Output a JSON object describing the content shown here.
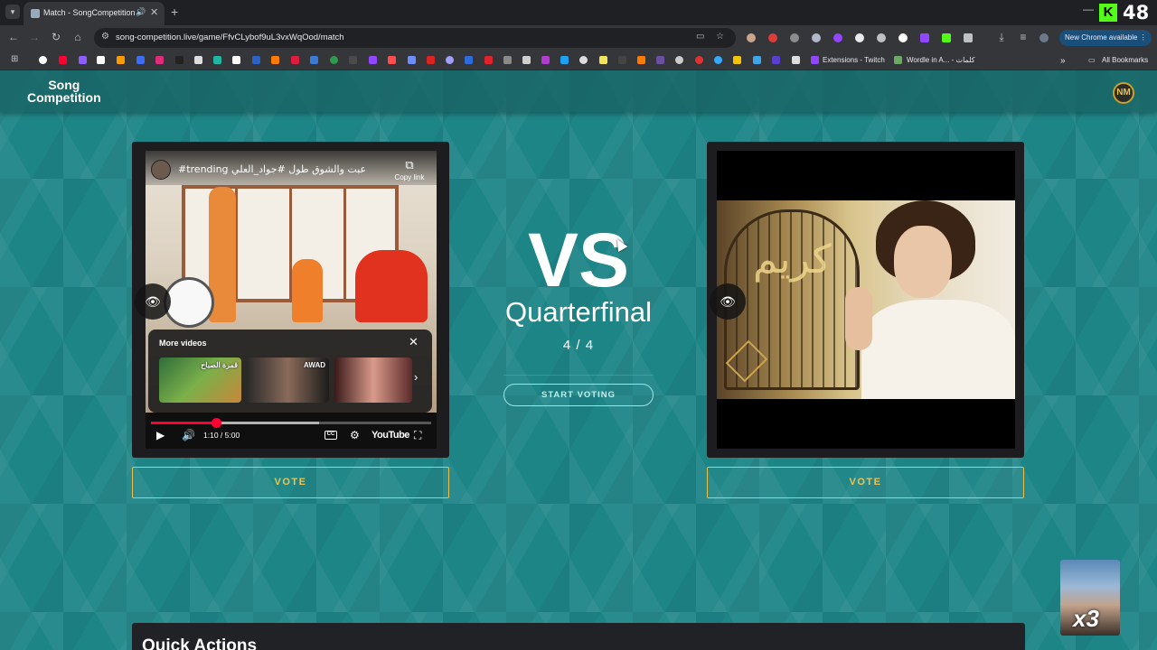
{
  "browser": {
    "tab_title": "Match - SongCompetition",
    "url": "song-competition.live/game/FfvCLybof9uL3vxWqOod/match",
    "update_button": "New Chrome available",
    "kick_count": "48",
    "bookmarks": {
      "extensions_label": "Extensions - Twitch",
      "wordle_label": "Wordle in A... - كلمات",
      "all_bookmarks": "All Bookmarks"
    }
  },
  "site": {
    "logo_line1": "Song",
    "logo_line2": "Competition"
  },
  "match": {
    "vs_label": "VS",
    "round_name": "Quarterfinal",
    "round_progress": "4 / 4",
    "start_voting": "START VOTING",
    "vote_left": "VOTE",
    "vote_right": "VOTE"
  },
  "left_video": {
    "title": "#trending عبت والشوق طول #جواد_العلي",
    "copy_link": "Copy link",
    "more_videos": "More videos",
    "thumb1_caption": "قمرة الصباح",
    "thumb2_caption": "AWAD",
    "time": "1:10 / 5:00",
    "progress_fraction": 0.233,
    "buffered_fraction": 0.6,
    "brand": "YouTube"
  },
  "quick_actions": {
    "title": "Quick Actions"
  },
  "overlay": {
    "cam_label": "x3"
  },
  "colors": {
    "page_bg": "#1e8587",
    "vote_accent": "#e9c455",
    "start_btn_border": "#9fe3e4",
    "yt_red": "#ff0033"
  }
}
